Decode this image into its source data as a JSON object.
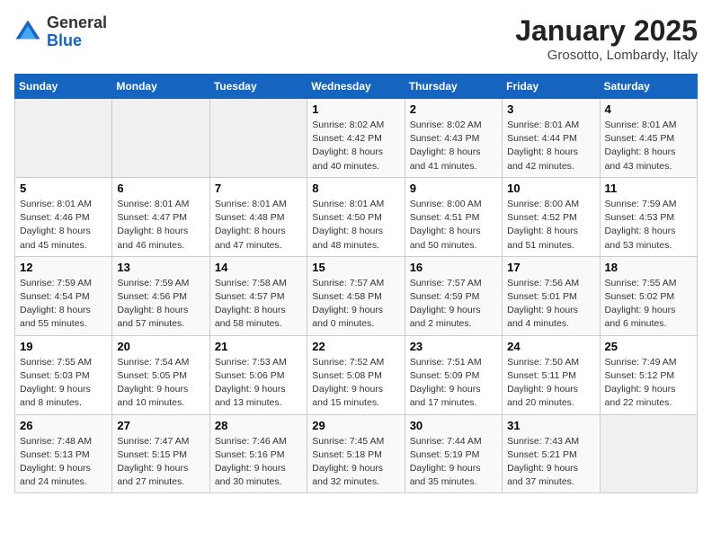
{
  "header": {
    "logo_general": "General",
    "logo_blue": "Blue",
    "month_title": "January 2025",
    "location": "Grosotto, Lombardy, Italy"
  },
  "weekdays": [
    "Sunday",
    "Monday",
    "Tuesday",
    "Wednesday",
    "Thursday",
    "Friday",
    "Saturday"
  ],
  "weeks": [
    [
      {
        "day": "",
        "info": ""
      },
      {
        "day": "",
        "info": ""
      },
      {
        "day": "",
        "info": ""
      },
      {
        "day": "1",
        "info": "Sunrise: 8:02 AM\nSunset: 4:42 PM\nDaylight: 8 hours\nand 40 minutes."
      },
      {
        "day": "2",
        "info": "Sunrise: 8:02 AM\nSunset: 4:43 PM\nDaylight: 8 hours\nand 41 minutes."
      },
      {
        "day": "3",
        "info": "Sunrise: 8:01 AM\nSunset: 4:44 PM\nDaylight: 8 hours\nand 42 minutes."
      },
      {
        "day": "4",
        "info": "Sunrise: 8:01 AM\nSunset: 4:45 PM\nDaylight: 8 hours\nand 43 minutes."
      }
    ],
    [
      {
        "day": "5",
        "info": "Sunrise: 8:01 AM\nSunset: 4:46 PM\nDaylight: 8 hours\nand 45 minutes."
      },
      {
        "day": "6",
        "info": "Sunrise: 8:01 AM\nSunset: 4:47 PM\nDaylight: 8 hours\nand 46 minutes."
      },
      {
        "day": "7",
        "info": "Sunrise: 8:01 AM\nSunset: 4:48 PM\nDaylight: 8 hours\nand 47 minutes."
      },
      {
        "day": "8",
        "info": "Sunrise: 8:01 AM\nSunset: 4:50 PM\nDaylight: 8 hours\nand 48 minutes."
      },
      {
        "day": "9",
        "info": "Sunrise: 8:00 AM\nSunset: 4:51 PM\nDaylight: 8 hours\nand 50 minutes."
      },
      {
        "day": "10",
        "info": "Sunrise: 8:00 AM\nSunset: 4:52 PM\nDaylight: 8 hours\nand 51 minutes."
      },
      {
        "day": "11",
        "info": "Sunrise: 7:59 AM\nSunset: 4:53 PM\nDaylight: 8 hours\nand 53 minutes."
      }
    ],
    [
      {
        "day": "12",
        "info": "Sunrise: 7:59 AM\nSunset: 4:54 PM\nDaylight: 8 hours\nand 55 minutes."
      },
      {
        "day": "13",
        "info": "Sunrise: 7:59 AM\nSunset: 4:56 PM\nDaylight: 8 hours\nand 57 minutes."
      },
      {
        "day": "14",
        "info": "Sunrise: 7:58 AM\nSunset: 4:57 PM\nDaylight: 8 hours\nand 58 minutes."
      },
      {
        "day": "15",
        "info": "Sunrise: 7:57 AM\nSunset: 4:58 PM\nDaylight: 9 hours\nand 0 minutes."
      },
      {
        "day": "16",
        "info": "Sunrise: 7:57 AM\nSunset: 4:59 PM\nDaylight: 9 hours\nand 2 minutes."
      },
      {
        "day": "17",
        "info": "Sunrise: 7:56 AM\nSunset: 5:01 PM\nDaylight: 9 hours\nand 4 minutes."
      },
      {
        "day": "18",
        "info": "Sunrise: 7:55 AM\nSunset: 5:02 PM\nDaylight: 9 hours\nand 6 minutes."
      }
    ],
    [
      {
        "day": "19",
        "info": "Sunrise: 7:55 AM\nSunset: 5:03 PM\nDaylight: 9 hours\nand 8 minutes."
      },
      {
        "day": "20",
        "info": "Sunrise: 7:54 AM\nSunset: 5:05 PM\nDaylight: 9 hours\nand 10 minutes."
      },
      {
        "day": "21",
        "info": "Sunrise: 7:53 AM\nSunset: 5:06 PM\nDaylight: 9 hours\nand 13 minutes."
      },
      {
        "day": "22",
        "info": "Sunrise: 7:52 AM\nSunset: 5:08 PM\nDaylight: 9 hours\nand 15 minutes."
      },
      {
        "day": "23",
        "info": "Sunrise: 7:51 AM\nSunset: 5:09 PM\nDaylight: 9 hours\nand 17 minutes."
      },
      {
        "day": "24",
        "info": "Sunrise: 7:50 AM\nSunset: 5:11 PM\nDaylight: 9 hours\nand 20 minutes."
      },
      {
        "day": "25",
        "info": "Sunrise: 7:49 AM\nSunset: 5:12 PM\nDaylight: 9 hours\nand 22 minutes."
      }
    ],
    [
      {
        "day": "26",
        "info": "Sunrise: 7:48 AM\nSunset: 5:13 PM\nDaylight: 9 hours\nand 24 minutes."
      },
      {
        "day": "27",
        "info": "Sunrise: 7:47 AM\nSunset: 5:15 PM\nDaylight: 9 hours\nand 27 minutes."
      },
      {
        "day": "28",
        "info": "Sunrise: 7:46 AM\nSunset: 5:16 PM\nDaylight: 9 hours\nand 30 minutes."
      },
      {
        "day": "29",
        "info": "Sunrise: 7:45 AM\nSunset: 5:18 PM\nDaylight: 9 hours\nand 32 minutes."
      },
      {
        "day": "30",
        "info": "Sunrise: 7:44 AM\nSunset: 5:19 PM\nDaylight: 9 hours\nand 35 minutes."
      },
      {
        "day": "31",
        "info": "Sunrise: 7:43 AM\nSunset: 5:21 PM\nDaylight: 9 hours\nand 37 minutes."
      },
      {
        "day": "",
        "info": ""
      }
    ]
  ]
}
